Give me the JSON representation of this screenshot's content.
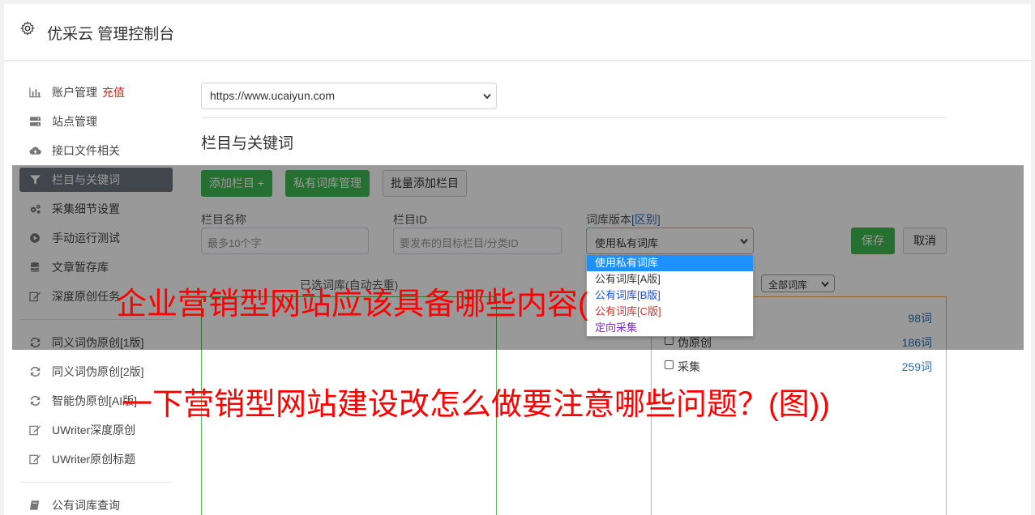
{
  "header": {
    "title": "优采云 管理控制台",
    "icon": "gear-icon"
  },
  "sidebar": {
    "items": [
      {
        "label": "账户管理",
        "extra": "充值",
        "icon": "bar-chart-icon"
      },
      {
        "label": "站点管理",
        "icon": "server-icon"
      },
      {
        "label": "接口文件相关",
        "icon": "cloud-upload-icon"
      },
      {
        "label": "栏目与关键词",
        "icon": "filter-icon",
        "active": true
      },
      {
        "label": "采集细节设置",
        "icon": "gears-icon"
      },
      {
        "label": "手动运行测试",
        "icon": "play-circle-icon"
      },
      {
        "label": "文章暂存库",
        "icon": "database-icon"
      },
      {
        "label": "深度原创任务",
        "icon": "edit-icon"
      },
      {
        "label": "同义词伪原创[1版]",
        "icon": "refresh-icon"
      },
      {
        "label": "同义词伪原创[2版]",
        "icon": "refresh-icon"
      },
      {
        "label": "智能伪原创[AI版]",
        "icon": "refresh-icon"
      },
      {
        "label": "UWriter深度原创",
        "icon": "edit-icon"
      },
      {
        "label": "UWriter原创标题",
        "icon": "edit-icon"
      },
      {
        "label": "公有词库查询",
        "icon": "book-icon"
      }
    ]
  },
  "site_select": {
    "value": "https://www.ucaiyun.com"
  },
  "section": {
    "title": "栏目与关键词"
  },
  "toolbar": {
    "add_column": "添加栏目 +",
    "private_lib": "私有词库管理",
    "batch_add": "批量添加栏目"
  },
  "form": {
    "col_name_label": "栏目名称",
    "col_name_placeholder": "最多10个字",
    "col_id_label": "栏目ID",
    "col_id_placeholder": "要发布的目标栏目/分类ID",
    "lib_version_label": "词库版本",
    "lib_version_hint": "[区别]",
    "lib_version_value": "使用私有词库",
    "save": "保存",
    "cancel": "取消"
  },
  "dropdown": {
    "options": [
      {
        "label": "使用私有词库",
        "selected": true
      },
      {
        "label": "公有词库[A版]"
      },
      {
        "label": "公有词库[B版]"
      },
      {
        "label": "公有词库[C版]"
      },
      {
        "label": "定向采集"
      }
    ]
  },
  "selected_lib": {
    "label": "已选词库(自动去重)"
  },
  "lib_filter": {
    "value": "全部词库"
  },
  "lib_list": [
    {
      "name": "",
      "count": "98词"
    },
    {
      "name": "伪原创",
      "count": "186词"
    },
    {
      "name": "采集",
      "count": "259词"
    }
  ],
  "watermark": {
    "line1": "企业营销型网站应该具备哪些内容(",
    "line2": "一下营销型网站建设改怎么做要注意哪些问题？(图))"
  },
  "colors": {
    "accent": "#3fb950",
    "active_nav": "#6c757d",
    "charge": "#d9251d",
    "watermark": "#ff0000"
  }
}
